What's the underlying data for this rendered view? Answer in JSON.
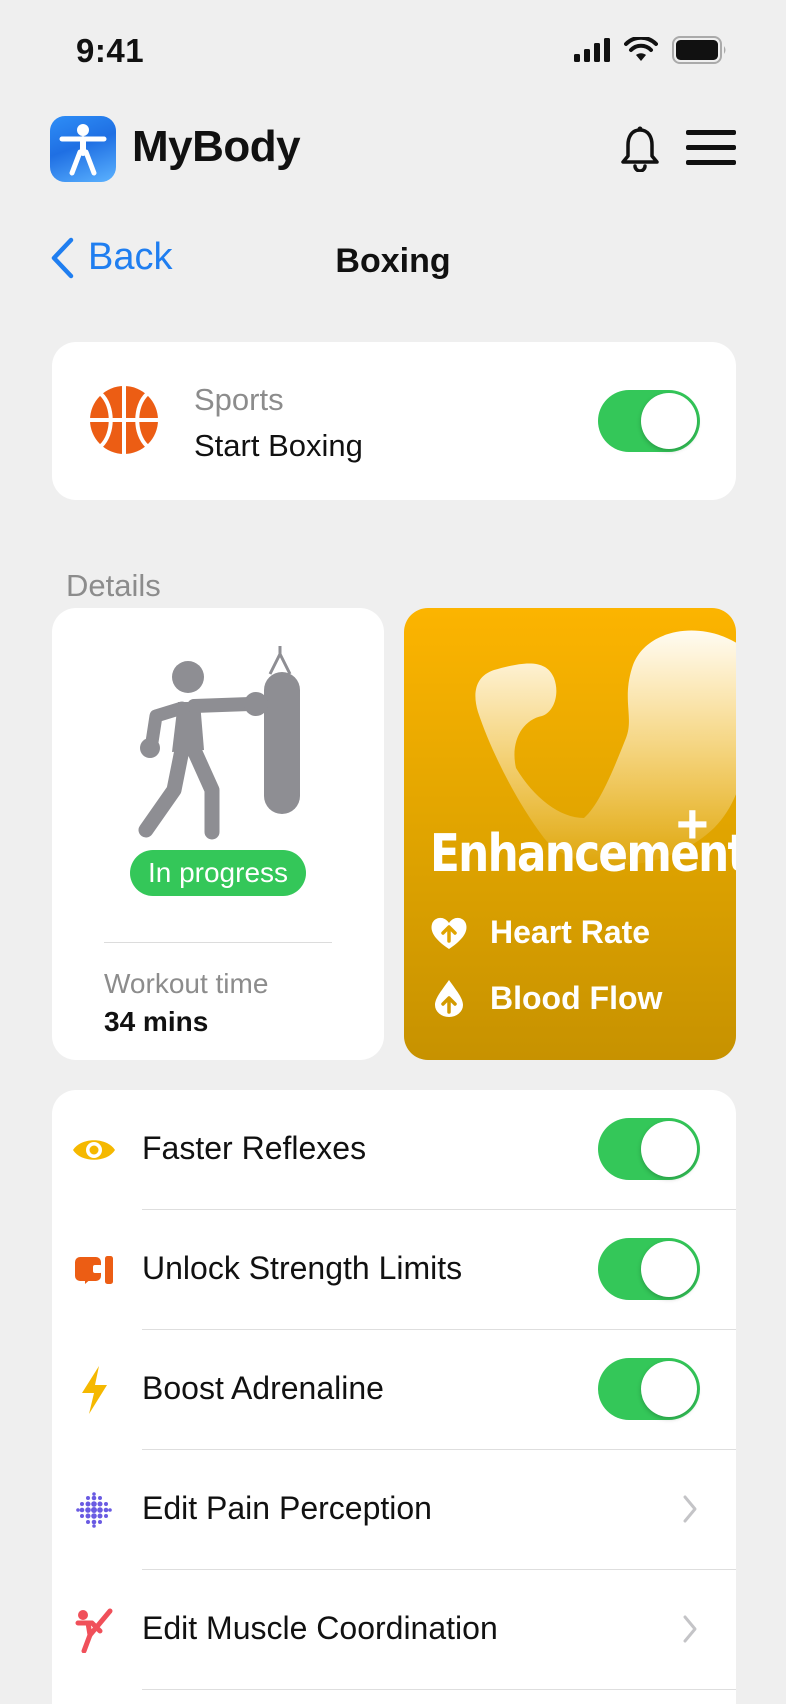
{
  "status_bar": {
    "time": "9:41",
    "icons": [
      "cellular-signal-icon",
      "wifi-icon",
      "battery-icon"
    ]
  },
  "header": {
    "app_name": "MyBody",
    "app_icon": "accessibility-figure-icon",
    "actions": [
      "bell-icon",
      "menu-icon"
    ]
  },
  "nav": {
    "back_label": "Back",
    "title": "Boxing"
  },
  "sports_card": {
    "category": "Sports",
    "activity": "Start Boxing",
    "icon": "basketball-icon",
    "toggle_on": true
  },
  "details": {
    "section_label": "Details",
    "workout": {
      "status": "In progress",
      "time_label": "Workout time",
      "time_value": "34 mins",
      "illustration": "boxer-punching-bag"
    },
    "enhancement": {
      "title": "Enhancement",
      "plus": "+",
      "items": [
        {
          "label": "Heart Rate",
          "icon": "heart-up-icon"
        },
        {
          "label": "Blood Flow",
          "icon": "drop-up-icon"
        }
      ]
    }
  },
  "settings": [
    {
      "label": "Faster Reflexes",
      "icon": "eye-icon",
      "type": "toggle",
      "value": true,
      "color": "#f5b800"
    },
    {
      "label": "Unlock Strength Limits",
      "icon": "dumbbell-icon",
      "type": "toggle",
      "value": true,
      "color": "#ec5d14"
    },
    {
      "label": "Boost Adrenaline",
      "icon": "lightning-icon",
      "type": "toggle",
      "value": true,
      "color": "#f5b800"
    },
    {
      "label": "Edit Pain Perception",
      "icon": "dot-grid-icon",
      "type": "link",
      "color": "#6a5be2"
    },
    {
      "label": "Edit Muscle Coordination",
      "icon": "martial-arts-icon",
      "type": "link",
      "color": "#f0505a"
    }
  ],
  "colors": {
    "accent_blue": "#1f7ef0",
    "toggle_green": "#34c759",
    "enhancement_gold": "#f0ac00",
    "background": "#efefef"
  }
}
